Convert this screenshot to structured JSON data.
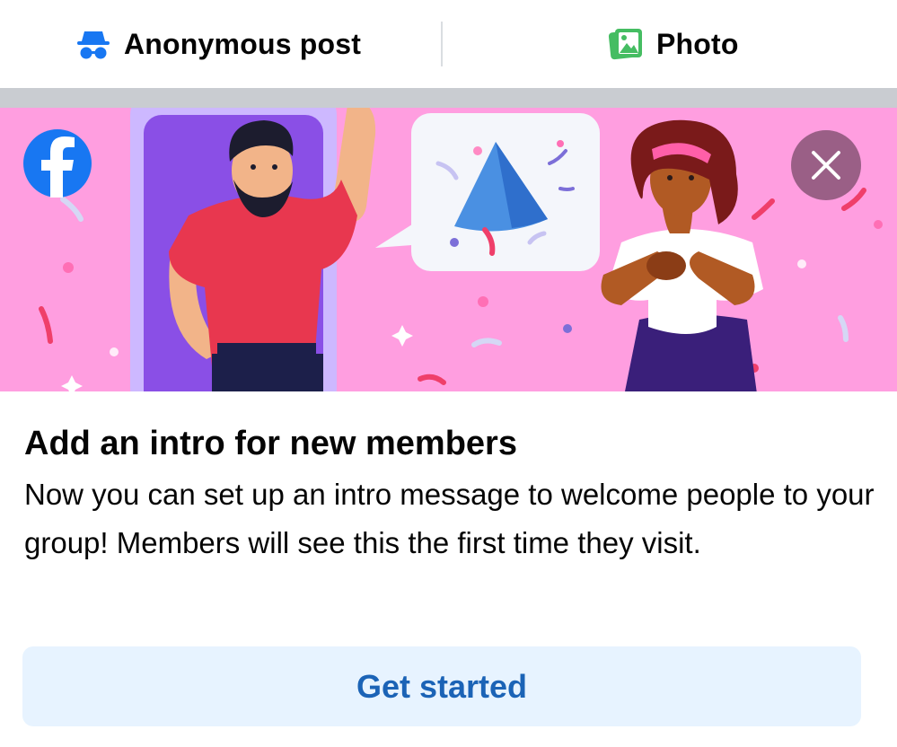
{
  "composer": {
    "anonymous_label": "Anonymous post",
    "photo_label": "Photo",
    "icons": {
      "anonymous": "incognito-icon",
      "photo": "photo-icon"
    }
  },
  "banner": {
    "icons": {
      "logo": "facebook-logo-icon",
      "close": "close-icon"
    },
    "colors": {
      "background": "#ff9ee0",
      "logo": "#1877f2",
      "close_bg": "#9a5f86"
    }
  },
  "card": {
    "title": "Add an intro for new members",
    "description": "Now you can set up an intro message to welcome people to your group! Members will see this the first time they visit.",
    "button_label": "Get started"
  },
  "colors": {
    "button_bg": "#e7f3ff",
    "button_text": "#1b63b6",
    "separator": "#c9ccd1"
  }
}
